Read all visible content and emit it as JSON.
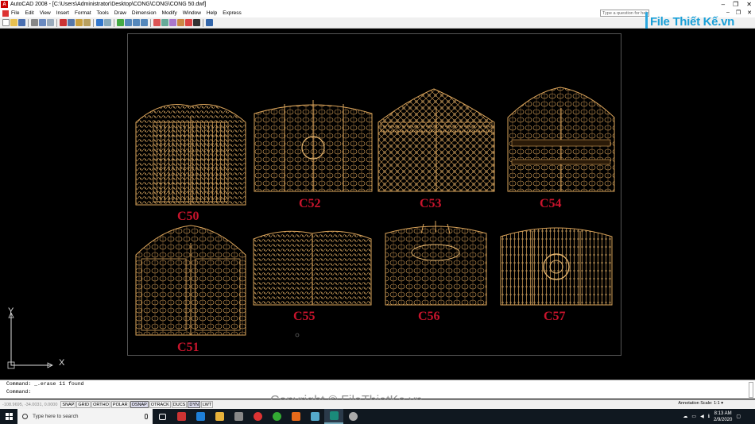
{
  "window": {
    "title": "AutoCAD 2008 - [C:\\Users\\Administrator\\Desktop\\CONG\\CONG\\CONG 50.dwf]",
    "minimize": "–",
    "maximize": "❐",
    "close": "✕",
    "doc_minimize": "–",
    "doc_maximize": "❐",
    "doc_close": "✕"
  },
  "menu": {
    "items": [
      "File",
      "Edit",
      "View",
      "Insert",
      "Format",
      "Tools",
      "Draw",
      "Dimension",
      "Modify",
      "Window",
      "Help",
      "Express"
    ]
  },
  "help_search": {
    "placeholder": "Type a question for help"
  },
  "watermark": {
    "logo_text": "File Thiết Kế.vn",
    "copyright": "Copyright © FileThietKe.vn"
  },
  "drawing": {
    "gate_labels": [
      "C50",
      "C52",
      "C53",
      "C54",
      "C51",
      "C55",
      "C56",
      "C57"
    ],
    "ucs_y": "Y",
    "ucs_x": "X",
    "colors": {
      "gate_line": "#d9a35a",
      "label": "#c8142c",
      "background": "#000000"
    }
  },
  "command": {
    "line1": "Command:  _.erase 11 found",
    "line2": "Command:"
  },
  "status": {
    "coords": "-108.9695, -34.0031, 0.0000",
    "toggles": [
      {
        "label": "SNAP",
        "on": false
      },
      {
        "label": "GRID",
        "on": false
      },
      {
        "label": "ORTHO",
        "on": false
      },
      {
        "label": "POLAR",
        "on": false
      },
      {
        "label": "OSNAP",
        "on": true
      },
      {
        "label": "OTRACK",
        "on": false
      },
      {
        "label": "DUCS",
        "on": false
      },
      {
        "label": "DYN",
        "on": true
      },
      {
        "label": "LWT",
        "on": false
      }
    ],
    "annotation_scale": "Annotation Scale:  1:1 ▾"
  },
  "taskbar": {
    "search_placeholder": "Type here to search",
    "time": "8:13 AM",
    "date": "2/9/2020"
  }
}
